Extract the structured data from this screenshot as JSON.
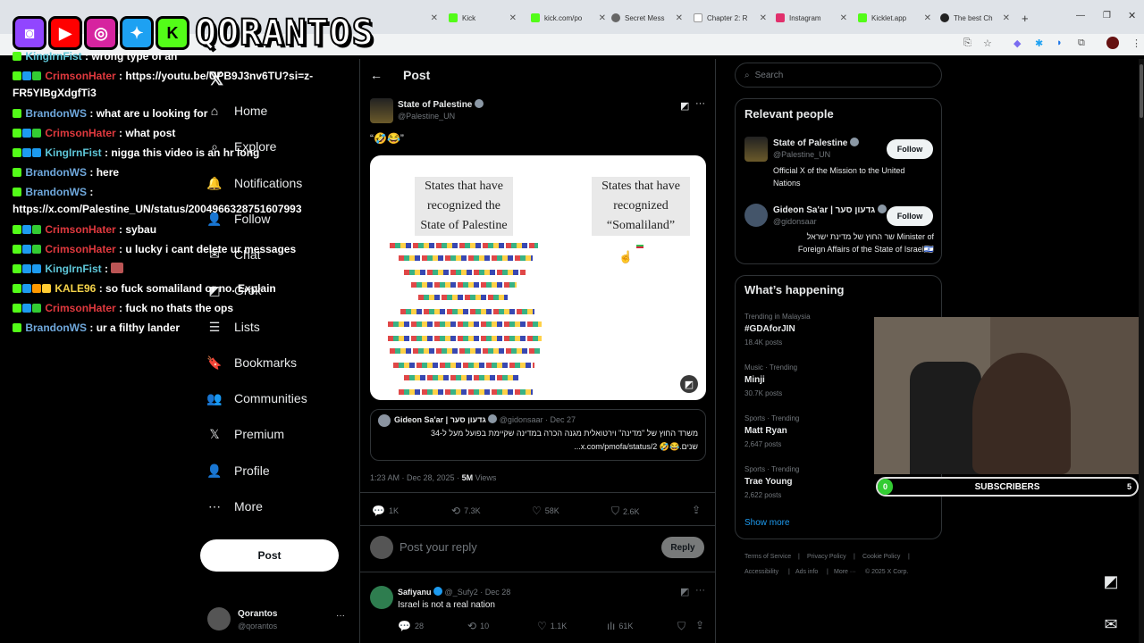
{
  "browser": {
    "tabs": [
      {
        "label": "",
        "color": "#888"
      },
      {
        "label": "Kick",
        "color": "#53fc18"
      },
      {
        "label": "kick.com/po",
        "color": "#53fc18"
      },
      {
        "label": "Secret Mess",
        "color": "#666"
      },
      {
        "label": "Chapter 2: R",
        "color": "#e8e8e8"
      },
      {
        "label": "Instagram",
        "color": "#e1306c"
      },
      {
        "label": "Kicklet.app",
        "color": "#53fc18"
      },
      {
        "label": "The best Ch",
        "color": "#222"
      }
    ],
    "new_tab": "+"
  },
  "overlay": {
    "brand": "QORANTOS",
    "logos": [
      {
        "name": "twitch-logo",
        "glyph": "◙",
        "color": "#9146ff"
      },
      {
        "name": "youtube-logo",
        "glyph": "▶",
        "color": "#ff0000"
      },
      {
        "name": "instagram-logo",
        "glyph": "◎",
        "color": "#d6249f"
      },
      {
        "name": "twitter-logo",
        "glyph": "✦",
        "color": "#1da1f2"
      },
      {
        "name": "kick-logo",
        "glyph": "K",
        "color": "#53fc18"
      }
    ]
  },
  "chat": {
    "lines": [
      {
        "user": "KingIrnFist",
        "sep": " : ",
        "msg": "wrong type of an",
        "user_class": "u-teal"
      },
      {
        "user": "CrimsonHater",
        "sep": " : ",
        "msg": "https://youtu.be/UPB9J3nv6TU?si=z-",
        "user_class": "u-red"
      },
      {
        "user": "",
        "sep": "",
        "msg": "FR5YIBgXdgfTi3",
        "user_class": ""
      },
      {
        "user": "BrandonWS",
        "sep": " : ",
        "msg": "what are u looking for",
        "user_class": "u-blue"
      },
      {
        "user": "CrimsonHater",
        "sep": " : ",
        "msg": "what post",
        "user_class": "u-red"
      },
      {
        "user": "KingIrnFist",
        "sep": " : ",
        "msg": "nigga this video is an hr long",
        "user_class": "u-teal"
      },
      {
        "user": "BrandonWS",
        "sep": " : ",
        "msg": "here",
        "user_class": "u-blue"
      },
      {
        "user": "BrandonWS",
        "sep": " :",
        "msg": "",
        "user_class": "u-blue"
      },
      {
        "user": "",
        "sep": "",
        "msg": "https://x.com/Palestine_UN/status/2004966328751607993",
        "user_class": ""
      },
      {
        "user": "CrimsonHater",
        "sep": " : ",
        "msg": "sybau",
        "user_class": "u-red"
      },
      {
        "user": "CrimsonHater",
        "sep": " : ",
        "msg": "u lucky i cant delete ur messages",
        "user_class": "u-red"
      },
      {
        "user": "KingIrnFist",
        "sep": " : ",
        "msg": "",
        "user_class": "u-teal"
      },
      {
        "user": "KALE96",
        "sep": " : ",
        "msg": "so fuck somaliland or no. Explain",
        "user_class": "u-yellow"
      },
      {
        "user": "CrimsonHater",
        "sep": " : ",
        "msg": "fuck no thats the ops",
        "user_class": "u-red"
      },
      {
        "user": "BrandonWS",
        "sep": " : ",
        "msg": "ur a filthy lander",
        "user_class": "u-blue"
      }
    ]
  },
  "nav": {
    "items": [
      {
        "label": "Home",
        "icon": "home-icon",
        "glyph": "⌂"
      },
      {
        "label": "Explore",
        "icon": "search-icon",
        "glyph": "⌕"
      },
      {
        "label": "Notifications",
        "icon": "bell-icon",
        "glyph": "🔔"
      },
      {
        "label": "Follow",
        "icon": "follow-icon",
        "glyph": "👤"
      },
      {
        "label": "Chat",
        "icon": "chat-icon",
        "glyph": "✉"
      },
      {
        "label": "Grok",
        "icon": "grok-icon",
        "glyph": "◩"
      },
      {
        "label": "Lists",
        "icon": "list-icon",
        "glyph": "☰"
      },
      {
        "label": "Bookmarks",
        "icon": "bookmark-icon",
        "glyph": "🔖"
      },
      {
        "label": "Communities",
        "icon": "communities-icon",
        "glyph": "👥"
      },
      {
        "label": "Premium",
        "icon": "x-premium-icon",
        "glyph": "𝕏"
      },
      {
        "label": "Profile",
        "icon": "profile-icon",
        "glyph": "👤"
      },
      {
        "label": "More",
        "icon": "more-icon",
        "glyph": "⋯"
      }
    ],
    "post_button": "Post",
    "account": {
      "name": "Qorantos",
      "handle": "@qorantos",
      "menu": "···"
    }
  },
  "center": {
    "header": {
      "back": "←",
      "title": "Post"
    },
    "tweet": {
      "author": "State of Palestine",
      "handle": "@Palestine_UN",
      "text": "“🤣😂”",
      "image": {
        "left_title": "States that have recognized the State of Palestine",
        "right_title": "States that have recognized “Somaliland”"
      },
      "quote": {
        "author": "Gideon Sa'ar | גדעון סער",
        "handle": "@gidonsaar",
        "date": "Dec 27",
        "text_line1": "משרד החוץ של \"מדינה\" וירטואלית מגנה הכרה במדינה שקיימת בפועל מעל ל-34",
        "text_line2": "שנים.😂🤣 x.com/pmofa/status/2..."
      },
      "meta": {
        "time": "1:23 AM · Dec 28, 2025 · ",
        "views": "5M",
        "views_label": " Views"
      },
      "actions": {
        "replies": "1K",
        "reposts": "7.3K",
        "likes": "58K",
        "bookmarks": "2.6K"
      }
    },
    "reply_box": {
      "placeholder": "Post your reply",
      "button": "Reply"
    },
    "reply": {
      "author": "Safiyanu",
      "handle": "@_Sufy2",
      "date": "Dec 28",
      "text": "Israel is not a real nation",
      "actions": {
        "replies": "28",
        "reposts": "10",
        "likes": "1.1K",
        "views": "61K"
      }
    }
  },
  "right": {
    "search_placeholder": "Search",
    "relevant": {
      "title": "Relevant people",
      "people": [
        {
          "name": "State of Palestine",
          "handle": "@Palestine_UN",
          "bio": "Official X of the Mission to the United Nations",
          "follow": "Follow"
        },
        {
          "name": "Gideon Sa'ar | גדעון סער",
          "handle": "@gidonsaar",
          "bio_line1": "שר החוץ של מדינת ישראל Minister of",
          "bio_line2": "Foreign Affairs of the State of Israel🇮🇱",
          "follow": "Follow"
        }
      ]
    },
    "happening": {
      "title": "What’s happening",
      "trends": [
        {
          "category": "Trending in Malaysia",
          "name": "#GDAforJIN",
          "count": "18.4K posts"
        },
        {
          "category": "Music · Trending",
          "name": "Minji",
          "count": "30.7K posts"
        },
        {
          "category": "Sports · Trending",
          "name": "Matt Ryan",
          "count": "2,647 posts"
        },
        {
          "category": "Sports · Trending",
          "name": "Trae Young",
          "count": "2,622 posts"
        }
      ],
      "show_more": "Show more"
    },
    "footer": [
      "Terms of Service",
      "|",
      "Privacy Policy",
      "|",
      "Cookie Policy",
      "|",
      "Accessibility",
      "|",
      "Ads info",
      "|",
      "More ···",
      "© 2025 X Corp."
    ]
  },
  "widgets": {
    "subs_label": "SUBSCRIBERS",
    "subs_current": "0",
    "subs_goal": "5",
    "subs_progress": 0.05
  }
}
